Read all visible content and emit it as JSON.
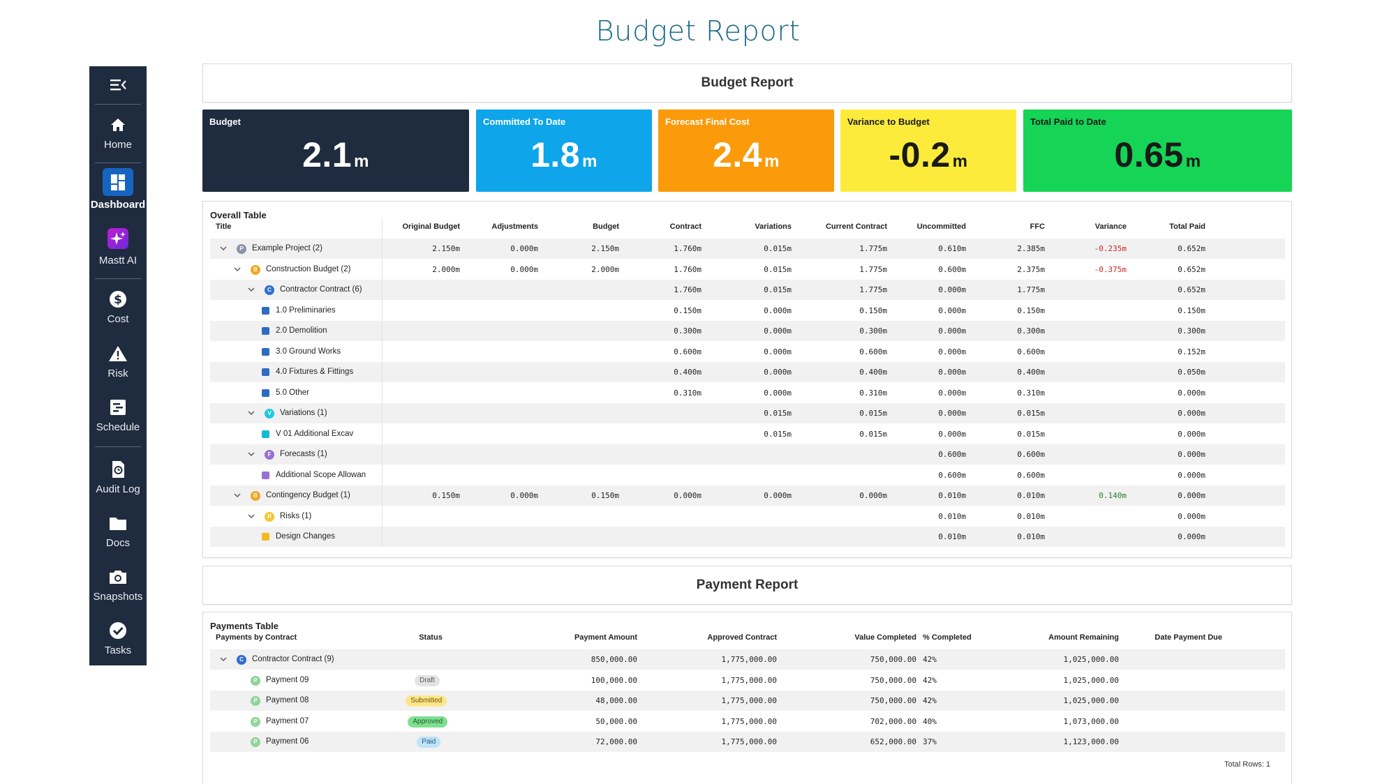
{
  "page_title": "Budget Report",
  "sidebar": {
    "items": [
      {
        "label": "Home",
        "icon": "home-icon"
      },
      {
        "label": "Dashboard",
        "icon": "dashboard-icon",
        "active": true
      },
      {
        "label": "Mastt AI",
        "icon": "ai-sparkle-icon"
      },
      {
        "label": "Cost",
        "icon": "dollar-icon"
      },
      {
        "label": "Risk",
        "icon": "warning-icon"
      },
      {
        "label": "Schedule",
        "icon": "schedule-icon"
      },
      {
        "label": "Audit Log",
        "icon": "audit-log-icon"
      },
      {
        "label": "Docs",
        "icon": "folder-icon"
      },
      {
        "label": "Snapshots",
        "icon": "camera-icon"
      },
      {
        "label": "Tasks",
        "icon": "check-circle-icon"
      }
    ]
  },
  "budget_panel": {
    "title": "Budget Report"
  },
  "kpis": [
    {
      "title": "Budget",
      "value": "2.1",
      "unit": "m",
      "bg": "#1f2b3e",
      "fg": "#ffffff"
    },
    {
      "title": "Committed To Date",
      "value": "1.8",
      "unit": "m",
      "bg": "#0ea5ea",
      "fg": "#ffffff"
    },
    {
      "title": "Forecast Final Cost",
      "value": "2.4",
      "unit": "m",
      "bg": "#fb9a0a",
      "fg": "#ffffff"
    },
    {
      "title": "Variance to Budget",
      "value": "-0.2",
      "unit": "m",
      "bg": "#fdeb3b",
      "fg": "#1a1a1a"
    },
    {
      "title": "Total Paid to Date",
      "value": "0.65",
      "unit": "m",
      "bg": "#16d456",
      "fg": "#1a1a1a"
    }
  ],
  "overall_table": {
    "title": "Overall Table",
    "columns": [
      "Title",
      "Original Budget",
      "Adjustments",
      "Budget",
      "Contract",
      "Variations",
      "Current Contract",
      "Uncommitted",
      "FFC",
      "Variance",
      "Total Paid"
    ],
    "rows": [
      {
        "title": "Example Project  (2)",
        "badge": "P",
        "badge_color": "#8a94a6",
        "expand": true,
        "cells": [
          "2.150m",
          "0.000m",
          "2.150m",
          "1.760m",
          "0.015m",
          "1.775m",
          "0.610m",
          "2.385m",
          "-0.235m",
          "0.652m"
        ]
      },
      {
        "title": "Construction Budget  (2)",
        "badge": "B",
        "badge_color": "#f5a623",
        "expand": true,
        "cells": [
          "2.000m",
          "0.000m",
          "2.000m",
          "1.760m",
          "0.015m",
          "1.775m",
          "0.600m",
          "2.375m",
          "-0.375m",
          "0.652m"
        ]
      },
      {
        "title": "Contractor Contract  (6)",
        "badge": "C",
        "badge_color": "#2f6fd1",
        "expand": true,
        "cells": [
          "",
          "",
          "",
          "1.760m",
          "0.015m",
          "1.775m",
          "0.000m",
          "1.775m",
          "",
          "0.652m"
        ]
      },
      {
        "title": "1.0 Preliminaries",
        "square": "#2d6cc0",
        "cells": [
          "",
          "",
          "",
          "0.150m",
          "0.000m",
          "0.150m",
          "0.000m",
          "0.150m",
          "",
          "0.150m"
        ]
      },
      {
        "title": "2.0 Demolition",
        "square": "#2d6cc0",
        "cells": [
          "",
          "",
          "",
          "0.300m",
          "0.000m",
          "0.300m",
          "0.000m",
          "0.300m",
          "",
          "0.300m"
        ]
      },
      {
        "title": "3.0 Ground Works",
        "square": "#2d6cc0",
        "cells": [
          "",
          "",
          "",
          "0.600m",
          "0.000m",
          "0.600m",
          "0.000m",
          "0.600m",
          "",
          "0.152m"
        ]
      },
      {
        "title": "4.0 Fixtures & Fittings",
        "square": "#2d6cc0",
        "cells": [
          "",
          "",
          "",
          "0.400m",
          "0.000m",
          "0.400m",
          "0.000m",
          "0.400m",
          "",
          "0.050m"
        ]
      },
      {
        "title": "5.0 Other",
        "square": "#2d6cc0",
        "cells": [
          "",
          "",
          "",
          "0.310m",
          "0.000m",
          "0.310m",
          "0.000m",
          "0.310m",
          "",
          "0.000m"
        ]
      },
      {
        "title": "Variations  (1)",
        "badge": "V",
        "badge_color": "#1ec8e0",
        "expand": true,
        "cells": [
          "",
          "",
          "",
          "",
          "0.015m",
          "0.015m",
          "0.000m",
          "0.015m",
          "",
          "0.000m"
        ]
      },
      {
        "title": "V 01 Additional Excav",
        "square": "#1ab8d4",
        "cells": [
          "",
          "",
          "",
          "",
          "0.015m",
          "0.015m",
          "0.000m",
          "0.015m",
          "",
          "0.000m"
        ]
      },
      {
        "title": "Forecasts  (1)",
        "badge": "F",
        "badge_color": "#9b6fd6",
        "expand": true,
        "cells": [
          "",
          "",
          "",
          "",
          "",
          "",
          "0.600m",
          "0.600m",
          "",
          "0.000m"
        ]
      },
      {
        "title": "Additional Scope Allowan",
        "square": "#9b6fd6",
        "cells": [
          "",
          "",
          "",
          "",
          "",
          "",
          "0.600m",
          "0.600m",
          "",
          "0.000m"
        ]
      },
      {
        "title": "Contingency Budget  (1)",
        "badge": "B",
        "badge_color": "#f5a623",
        "expand": true,
        "cells": [
          "0.150m",
          "0.000m",
          "0.150m",
          "0.000m",
          "0.000m",
          "0.000m",
          "0.010m",
          "0.010m",
          "0.140m",
          "0.000m"
        ]
      },
      {
        "title": "Risks  (1)",
        "badge": "R",
        "badge_color": "#f7c531",
        "expand": true,
        "cells": [
          "",
          "",
          "",
          "",
          "",
          "",
          "0.010m",
          "0.010m",
          "",
          "0.000m"
        ]
      },
      {
        "title": "Design Changes",
        "square": "#f5b820",
        "cells": [
          "",
          "",
          "",
          "",
          "",
          "",
          "0.010m",
          "0.010m",
          "",
          "0.000m"
        ]
      }
    ]
  },
  "payment_panel": {
    "title": "Payment Report"
  },
  "payments_table": {
    "title": "Payments Table",
    "columns": [
      "Payments by Contract",
      "Status",
      "Payment Amount",
      "Approved Contract",
      "Value Completed",
      "% Completed",
      "Amount Remaining",
      "Date Payment Due"
    ],
    "rows": [
      {
        "title": "Contractor Contract  (9)",
        "badge": "C",
        "badge_color": "#2f6fd1",
        "expand": true,
        "status": "",
        "amount": "850,000.00",
        "approved": "1,775,000.00",
        "completed": "750,000.00",
        "pct": "42%",
        "remaining": "1,025,000.00",
        "due": ""
      },
      {
        "title": "Payment 09",
        "badge": "P",
        "badge_color": "#8fd49a",
        "status": "Draft",
        "status_bg": "#e3e3e3",
        "status_fg": "#555555",
        "amount": "100,000.00",
        "approved": "1,775,000.00",
        "completed": "750,000.00",
        "pct": "42%",
        "remaining": "1,025,000.00",
        "due": ""
      },
      {
        "title": "Payment 08",
        "badge": "P",
        "badge_color": "#8fd49a",
        "status": "Submitted",
        "status_bg": "#fde68a",
        "status_fg": "#6b5300",
        "amount": "48,000.00",
        "approved": "1,775,000.00",
        "completed": "750,000.00",
        "pct": "42%",
        "remaining": "1,025,000.00",
        "due": ""
      },
      {
        "title": "Payment 07",
        "badge": "P",
        "badge_color": "#8fd49a",
        "status": "Approved",
        "status_bg": "#7ee08f",
        "status_fg": "#1d5a2a",
        "amount": "50,000.00",
        "approved": "1,775,000.00",
        "completed": "702,000.00",
        "pct": "40%",
        "remaining": "1,073,000.00",
        "due": ""
      },
      {
        "title": "Payment 06",
        "badge": "P",
        "badge_color": "#8fd49a",
        "status": "Paid",
        "status_bg": "#bfe3f7",
        "status_fg": "#1f5b80",
        "amount": "72,000.00",
        "approved": "1,775,000.00",
        "completed": "652,000.00",
        "pct": "37%",
        "remaining": "1,123,000.00",
        "due": ""
      }
    ],
    "footer": "Total Rows: 1"
  }
}
